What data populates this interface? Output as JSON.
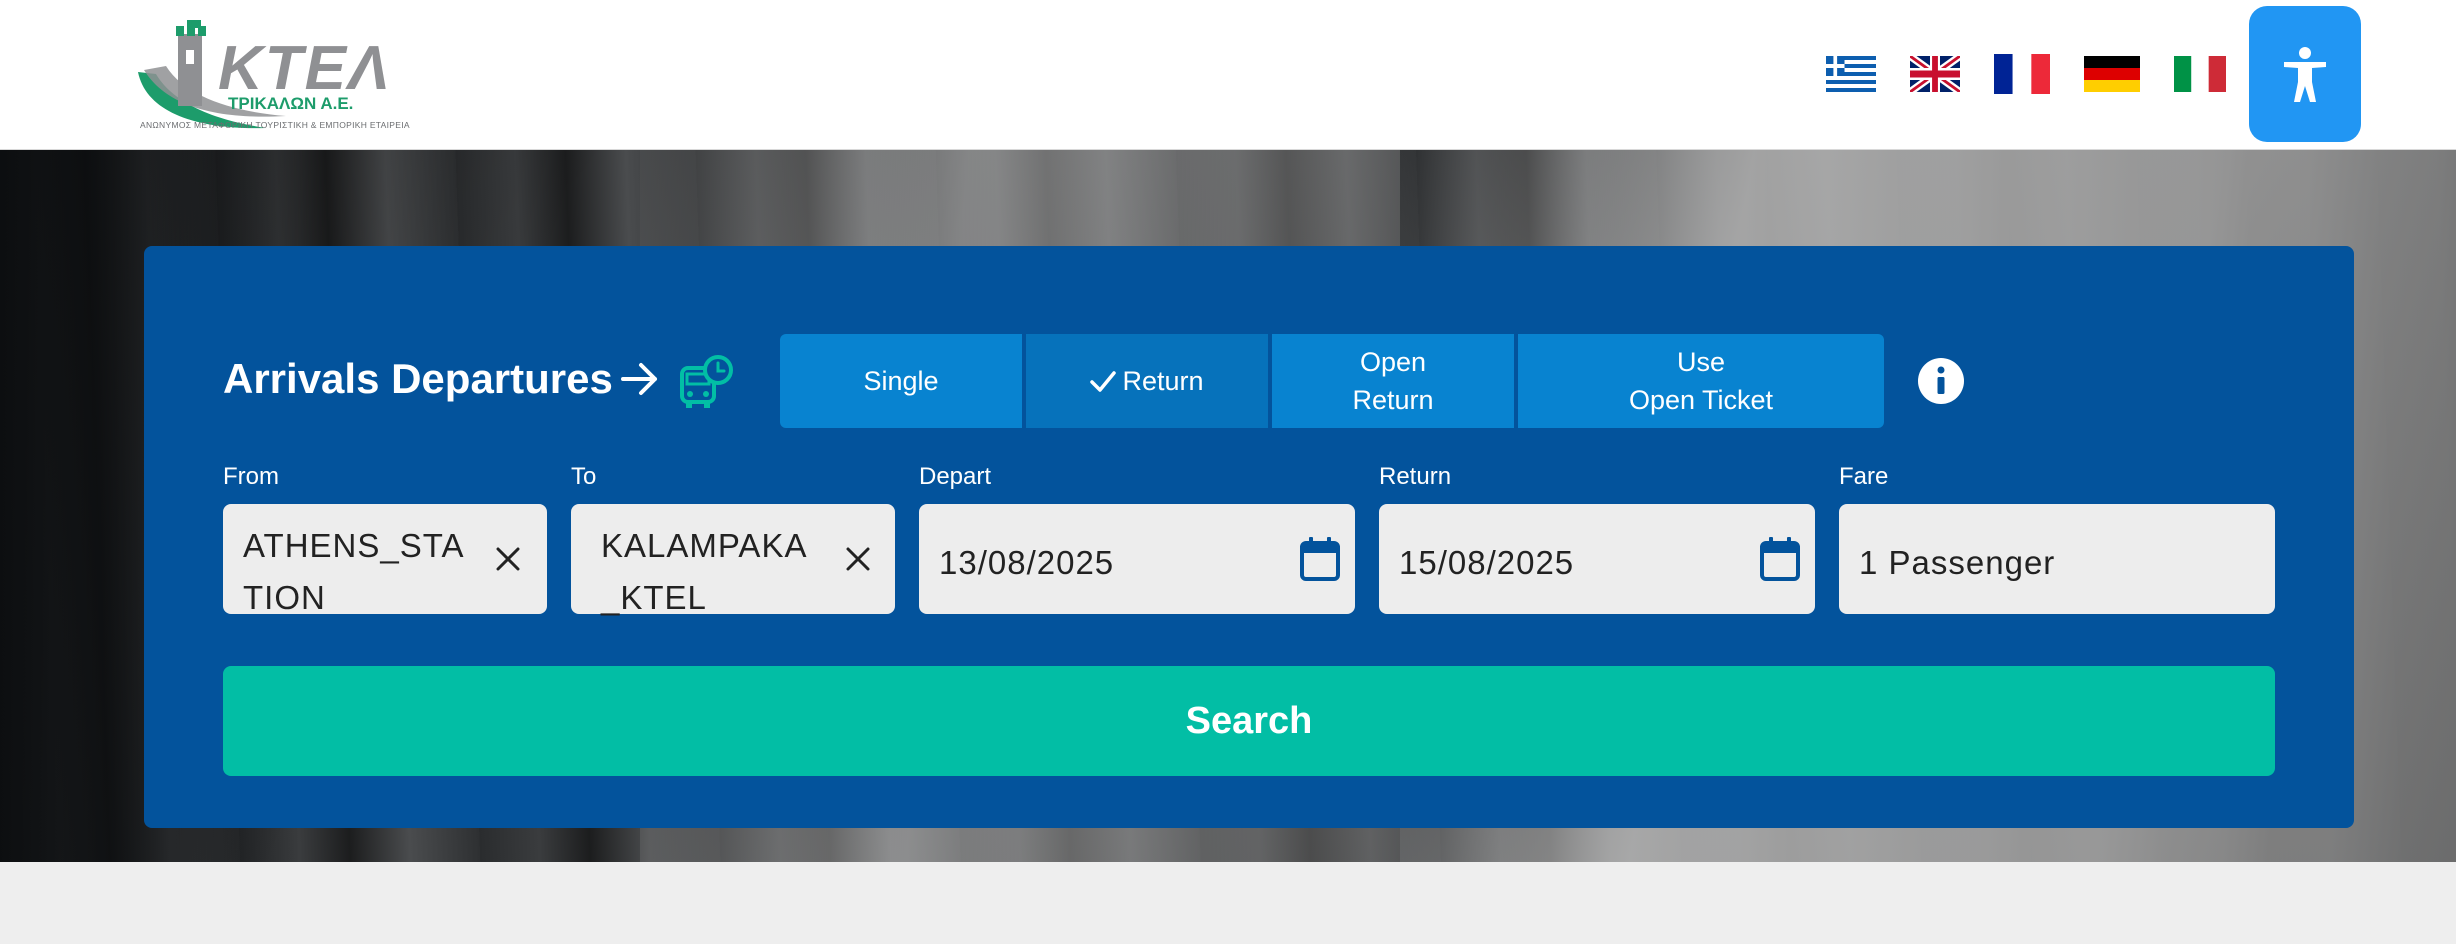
{
  "header": {
    "logo": {
      "name": "ΚΤΕΛ",
      "city": "ΤΡΙΚΑΛΩΝ Α.Ε.",
      "tagline": "ΑΝΩΝΥΜΟΣ ΜΕΤΑΦΟΡΙΚΗ ΤΟΥΡΙΣΤΙΚΗ & ΕΜΠΟΡΙΚΗ ΕΤΑΙΡΕΙΑ"
    },
    "languages": [
      "greece-flag-icon",
      "uk-flag-icon",
      "france-flag-icon",
      "germany-flag-icon",
      "italy-flag-icon"
    ],
    "accessibility_icon": "accessibility-icon"
  },
  "search": {
    "title": "Arrivals Departures",
    "trip_types": {
      "single": "Single",
      "return": "Return",
      "open_return_1": "Open",
      "open_return_2": "Return",
      "use_open_1": "Use",
      "use_open_2": "Open Ticket"
    },
    "selected_trip_type": "Return",
    "from": {
      "label": "From",
      "value": "ATHENS_STA\nTION"
    },
    "to": {
      "label": "To",
      "value": "KALAMPAKA\n_KTEL"
    },
    "depart": {
      "label": "Depart",
      "value": "13/08/2025"
    },
    "return": {
      "label": "Return",
      "value": "15/08/2025"
    },
    "fare": {
      "label": "Fare",
      "value": "1 Passenger"
    },
    "search_label": "Search"
  },
  "colors": {
    "panel": "#03539c",
    "trip_button": "#0883d0",
    "trip_button_active": "#0672bb",
    "search_button": "#02bea5",
    "accessibility_button": "#2196f3",
    "brand_green": "#1d9c6b"
  }
}
